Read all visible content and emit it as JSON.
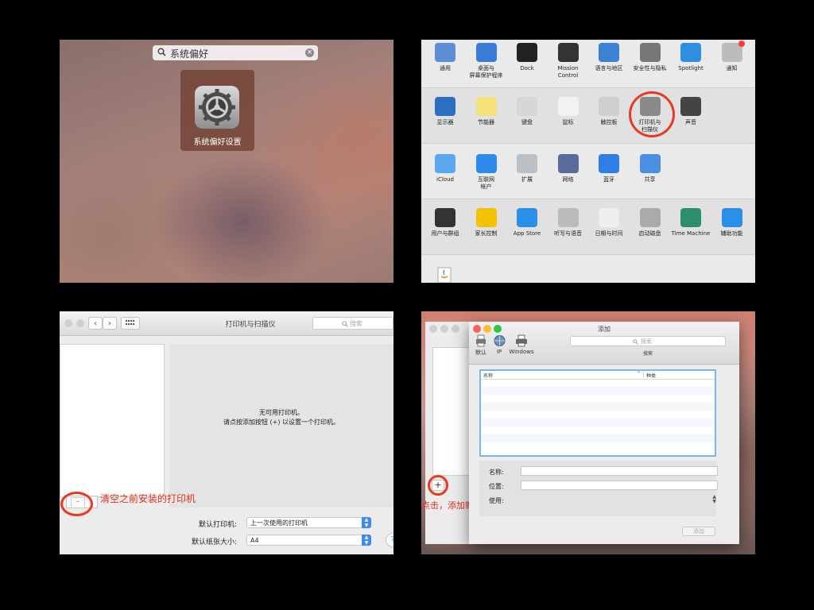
{
  "spotlight": {
    "query": "系统偏好",
    "result_label": "系统偏好设置"
  },
  "prefs": {
    "rows": [
      [
        {
          "label": "通用",
          "icon": "general-icon"
        },
        {
          "label": "桌面与\n屏幕保护程序",
          "icon": "desktop-icon"
        },
        {
          "label": "Dock",
          "icon": "dock-icon"
        },
        {
          "label": "Mission\nControl",
          "icon": "mission-control-icon"
        },
        {
          "label": "语言与地区",
          "icon": "language-icon"
        },
        {
          "label": "安全性与隐私",
          "icon": "security-icon"
        },
        {
          "label": "Spotlight",
          "icon": "spotlight-icon"
        },
        {
          "label": "通知",
          "icon": "notifications-icon"
        }
      ],
      [
        {
          "label": "显示器",
          "icon": "display-icon"
        },
        {
          "label": "节能器",
          "icon": "energy-icon"
        },
        {
          "label": "键盘",
          "icon": "keyboard-icon"
        },
        {
          "label": "鼠标",
          "icon": "mouse-icon"
        },
        {
          "label": "触控板",
          "icon": "trackpad-icon"
        },
        {
          "label": "打印机与\n扫描仪",
          "icon": "printer-icon"
        },
        {
          "label": "声音",
          "icon": "sound-icon"
        }
      ],
      [
        {
          "label": "iCloud",
          "icon": "icloud-icon"
        },
        {
          "label": "互联网\n帐户",
          "icon": "internet-accounts-icon"
        },
        {
          "label": "扩展",
          "icon": "extensions-icon"
        },
        {
          "label": "网络",
          "icon": "network-icon"
        },
        {
          "label": "蓝牙",
          "icon": "bluetooth-icon"
        },
        {
          "label": "共享",
          "icon": "sharing-icon"
        }
      ],
      [
        {
          "label": "用户与群组",
          "icon": "users-icon"
        },
        {
          "label": "家长控制",
          "icon": "parental-icon"
        },
        {
          "label": "App Store",
          "icon": "app-store-icon"
        },
        {
          "label": "听写与语音",
          "icon": "dictation-icon"
        },
        {
          "label": "日期与时间",
          "icon": "date-time-icon"
        },
        {
          "label": "启动磁盘",
          "icon": "startup-disk-icon"
        },
        {
          "label": "Time Machine",
          "icon": "time-machine-icon"
        },
        {
          "label": "辅助功能",
          "icon": "accessibility-icon"
        }
      ]
    ]
  },
  "printers": {
    "title": "打印机与扫描仪",
    "search_placeholder": "搜索",
    "empty_line1": "无可用打印机。",
    "empty_line2": "请点按添加按钮 (+) 以设置一个打印机。",
    "annotation": "清空之前安装的打印机",
    "default_printer_label": "默认打印机:",
    "default_printer_value": "上一次使用的打印机",
    "paper_size_label": "默认纸张大小:",
    "paper_size_value": "A4",
    "help": "?"
  },
  "add_dialog": {
    "title": "添加",
    "tools": [
      "默认",
      "IP",
      "Windows"
    ],
    "search_placeholder": "搜索",
    "search_caption": "搜索",
    "col_name": "名称",
    "col_kind": "种类",
    "name_label": "名称:",
    "location_label": "位置:",
    "use_label": "使用:",
    "add_button": "添加",
    "plus": "+",
    "annotation": "点击，添加新的打印机"
  },
  "colors": {
    "annotation": "#e0311c",
    "accent": "#3d8af7"
  }
}
